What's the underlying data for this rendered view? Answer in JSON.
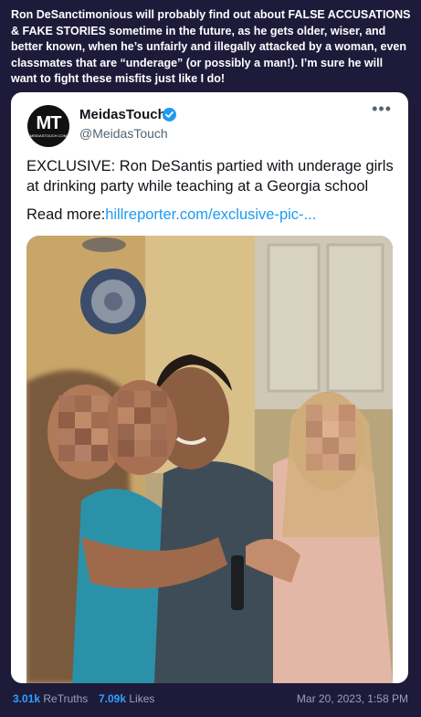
{
  "post": {
    "text": "Ron DeSanctimonious will probably find out about FALSE ACCUSATIONS & FAKE STORIES sometime in the future, as he gets older, wiser, and better known, when he’s unfairly and illegally attacked by a woman, even classmates that are “underage” (or possibly a man!). I’m sure he will want to fight these misfits just like I do!"
  },
  "embed": {
    "avatar_text": "MT",
    "avatar_subtext": "MEIDASTOUCH.COM",
    "author_name": "MeidasTouch",
    "author_handle": "@MeidasTouch",
    "more_icon": "more-horizontal-icon",
    "verified_icon": "verified-badge-icon",
    "text": "EXCLUSIVE: Ron DeSantis partied with underage girls at drinking party while teaching at a Georgia school",
    "read_more_label": "Read more:",
    "link_text": "hillreporter.com/exclusive-pic-...",
    "link_color": "#1d9bf0"
  },
  "footer": {
    "retruths_count": "3.01k",
    "retruths_label": "ReTruths",
    "likes_count": "7.09k",
    "likes_label": "Likes",
    "timestamp": "Mar 20, 2023, 1:58 PM"
  },
  "colors": {
    "background": "#1e1b3a",
    "accent": "#2aa3ff"
  }
}
